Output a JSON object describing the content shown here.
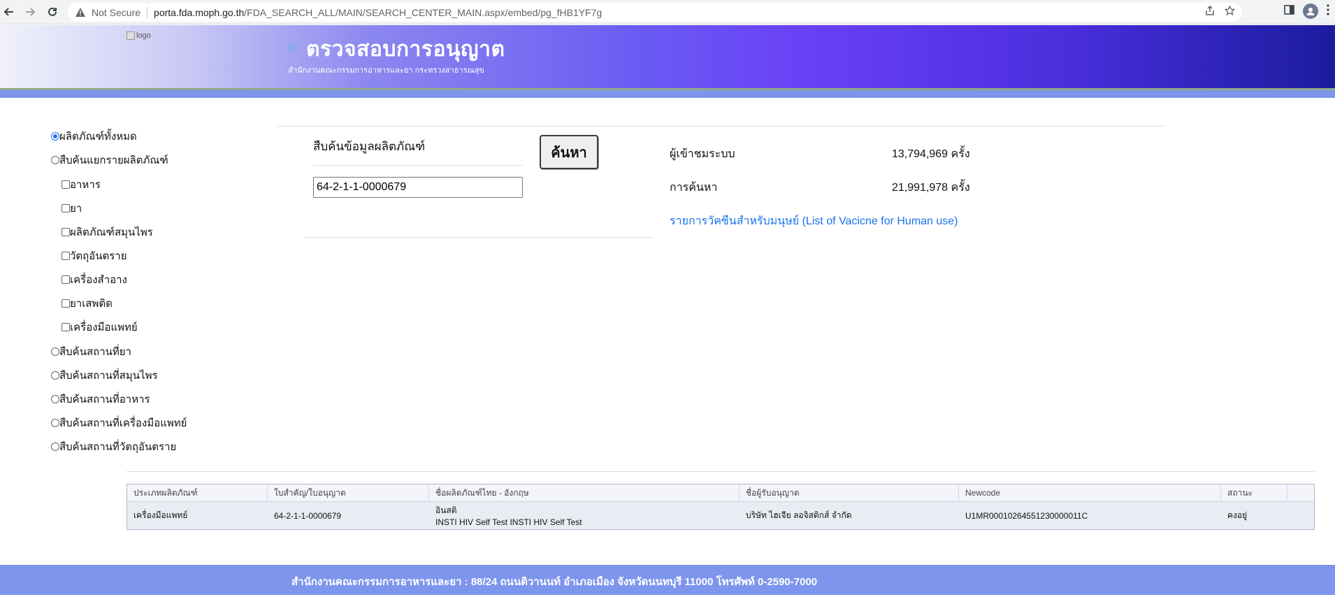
{
  "browser": {
    "security_label": "Not Secure",
    "url_host": "porta.fda.moph.go.th",
    "url_path": "/FDA_SEARCH_ALL/MAIN/SEARCH_CENTER_MAIN.aspx/embed/pg_fHB1YF7g"
  },
  "header": {
    "logo_alt": "logo",
    "title": "ตรวจสอบการอนุญาต",
    "subtitle": "สำนักงานคณะกรรมการอาหารและยา กระทรวงสาธารณสุข"
  },
  "menu": {
    "all_products": "ผลิตภัณฑ์ทั้งหมด",
    "by_product": "สืบค้นแยกรายผลิตภัณฑ์",
    "categories": [
      "อาหาร",
      "ยา",
      "ผลิตภัณฑ์สมุนไพร",
      "วัตถุอันตราย",
      "เครื่องสำอาง",
      "ยาเสพติด",
      "เครื่องมือแพทย์"
    ],
    "places": [
      "สืบค้นสถานที่ยา",
      "สืบค้นสถานที่สมุนไพร",
      "สืบค้นสถานที่อาหาร",
      "สืบค้นสถานที่เครื่องมือแพทย์",
      "สืบค้นสถานที่วัตถุอันตราย"
    ]
  },
  "search": {
    "label": "สืบค้นข้อมูลผลิตภัณฑ์",
    "value": "64-2-1-1-0000679",
    "button": "ค้นหา"
  },
  "stats": {
    "visitors_label": "ผู้เข้าชมระบบ",
    "visitors_value": "13,794,969 ครั้ง",
    "searches_label": "การค้นหา",
    "searches_value": "21,991,978 ครั้ง",
    "vaccine_link": "รายการวัคซีนสำหรับมนุษย์ (List of Vacicne for Human use)"
  },
  "table": {
    "headers": [
      "ประเภทผลิตภัณฑ์",
      "ใบสำคัญ/ใบอนุญาต",
      "ชื่อผลิตภัณฑ์ไทย - อังกฤษ",
      "ชื่อผู้รับอนุญาต",
      "Newcode",
      "สถานะ"
    ],
    "row": {
      "type": "เครื่องมือแพทย์",
      "license": "64-2-1-1-0000679",
      "name_th": "อินสติ",
      "name_en": "INSTI HIV Self Test INSTI HIV Self Test",
      "licensee": "บริษัท ไฮเจีย ลอจิสติกส์ จำกัด",
      "newcode": "U1MR00010264551230000011C",
      "status": "คงอยู่"
    }
  },
  "footer": {
    "text": "สำนักงานคณะกรรมการอาหารและยา : 88/24 ถนนติวานนท์ อำเภอเมือง จังหวัดนนทบุรี 11000 โทรศัพท์ 0-2590-7000"
  }
}
